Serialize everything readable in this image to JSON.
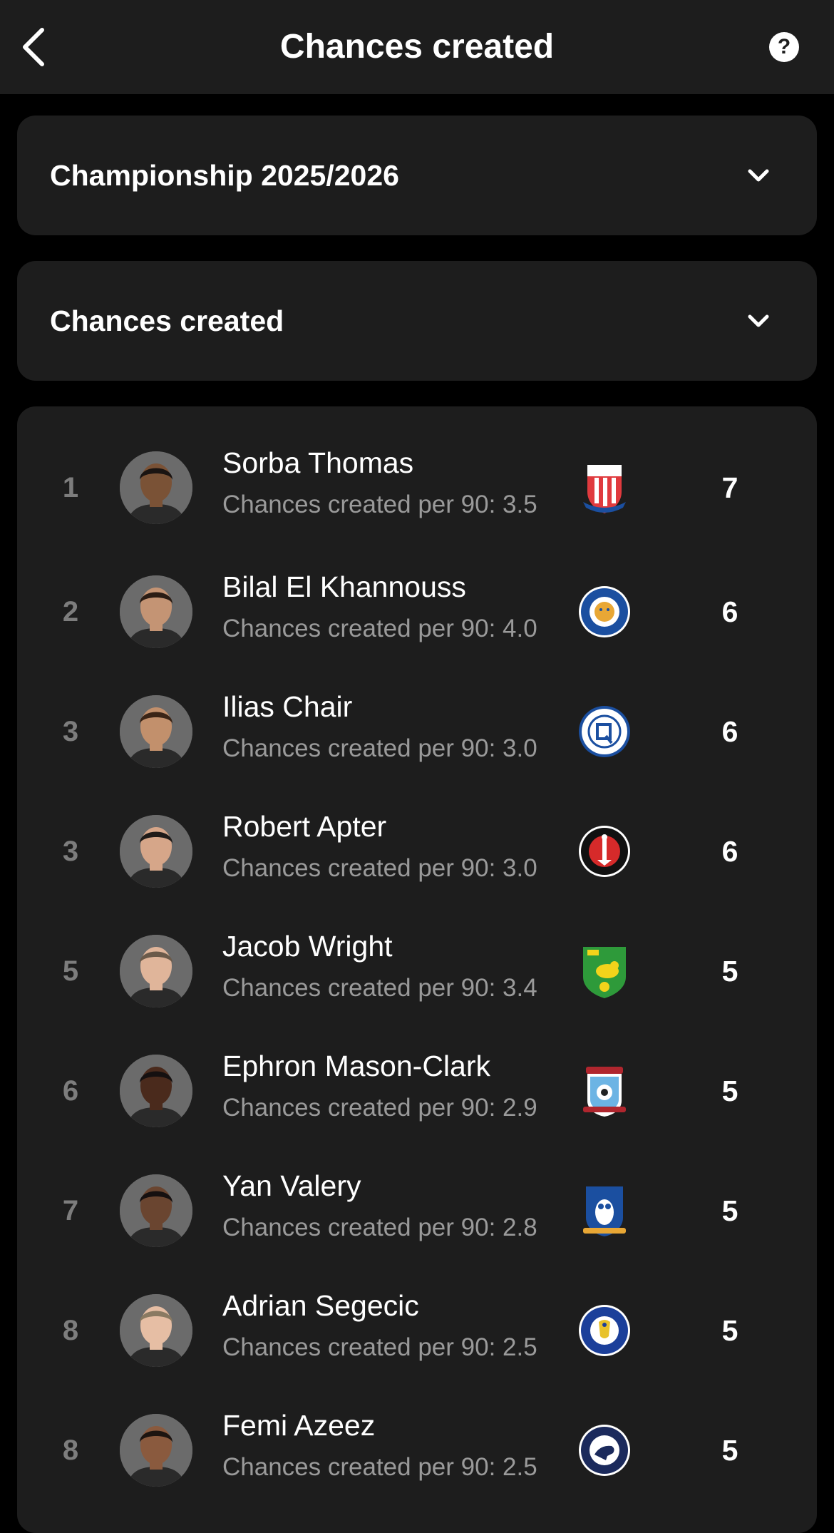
{
  "header": {
    "title": "Chances created",
    "help_label": "?"
  },
  "filters": {
    "league": "Championship 2025/2026",
    "stat": "Chances created"
  },
  "players": [
    {
      "rank": "1",
      "name": "Sorba Thomas",
      "per90": "Chances created per 90: 3.5",
      "value": "7",
      "club_icon": "stoke-city-crest-icon",
      "skin": "#7a5236",
      "hair": "#1a1412",
      "crest": "stoke"
    },
    {
      "rank": "2",
      "name": "Bilal El Khannouss",
      "per90": "Chances created per 90: 4.0",
      "value": "6",
      "club_icon": "leicester-city-crest-icon",
      "skin": "#c49474",
      "hair": "#2a1c14",
      "crest": "leicester"
    },
    {
      "rank": "3",
      "name": "Ilias Chair",
      "per90": "Chances created per 90: 3.0",
      "value": "6",
      "club_icon": "qpr-crest-icon",
      "skin": "#c2906c",
      "hair": "#3a2416",
      "crest": "qpr"
    },
    {
      "rank": "3",
      "name": "Robert Apter",
      "per90": "Chances created per 90: 3.0",
      "value": "6",
      "club_icon": "charlton-athletic-crest-icon",
      "skin": "#d6a689",
      "hair": "#1e1a18",
      "crest": "charlton"
    },
    {
      "rank": "5",
      "name": "Jacob Wright",
      "per90": "Chances created per 90: 3.4",
      "value": "5",
      "club_icon": "norwich-city-crest-icon",
      "skin": "#e0b59a",
      "hair": "#6b5a4a",
      "crest": "norwich"
    },
    {
      "rank": "6",
      "name": "Ephron Mason-Clark",
      "per90": "Chances created per 90: 2.9",
      "value": "5",
      "club_icon": "coventry-city-crest-icon",
      "skin": "#4a2a1c",
      "hair": "#151010",
      "crest": "coventry"
    },
    {
      "rank": "7",
      "name": "Yan Valery",
      "per90": "Chances created per 90: 2.8",
      "value": "5",
      "club_icon": "sheffield-wednesday-crest-icon",
      "skin": "#6a4530",
      "hair": "#161010",
      "crest": "sheffield"
    },
    {
      "rank": "8",
      "name": "Adrian Segecic",
      "per90": "Chances created per 90: 2.5",
      "value": "5",
      "club_icon": "portsmouth-crest-icon",
      "skin": "#e6bea4",
      "hair": "#8a7a62",
      "crest": "portsmouth"
    },
    {
      "rank": "8",
      "name": "Femi Azeez",
      "per90": "Chances created per 90: 2.5",
      "value": "5",
      "club_icon": "millwall-crest-icon",
      "skin": "#8a5a3e",
      "hair": "#1c1410",
      "crest": "millwall"
    }
  ],
  "colors": {
    "background": "#000000",
    "card": "#1d1d1d",
    "rank_text": "#7d7d7d",
    "secondary_text": "#9a9a9a"
  }
}
